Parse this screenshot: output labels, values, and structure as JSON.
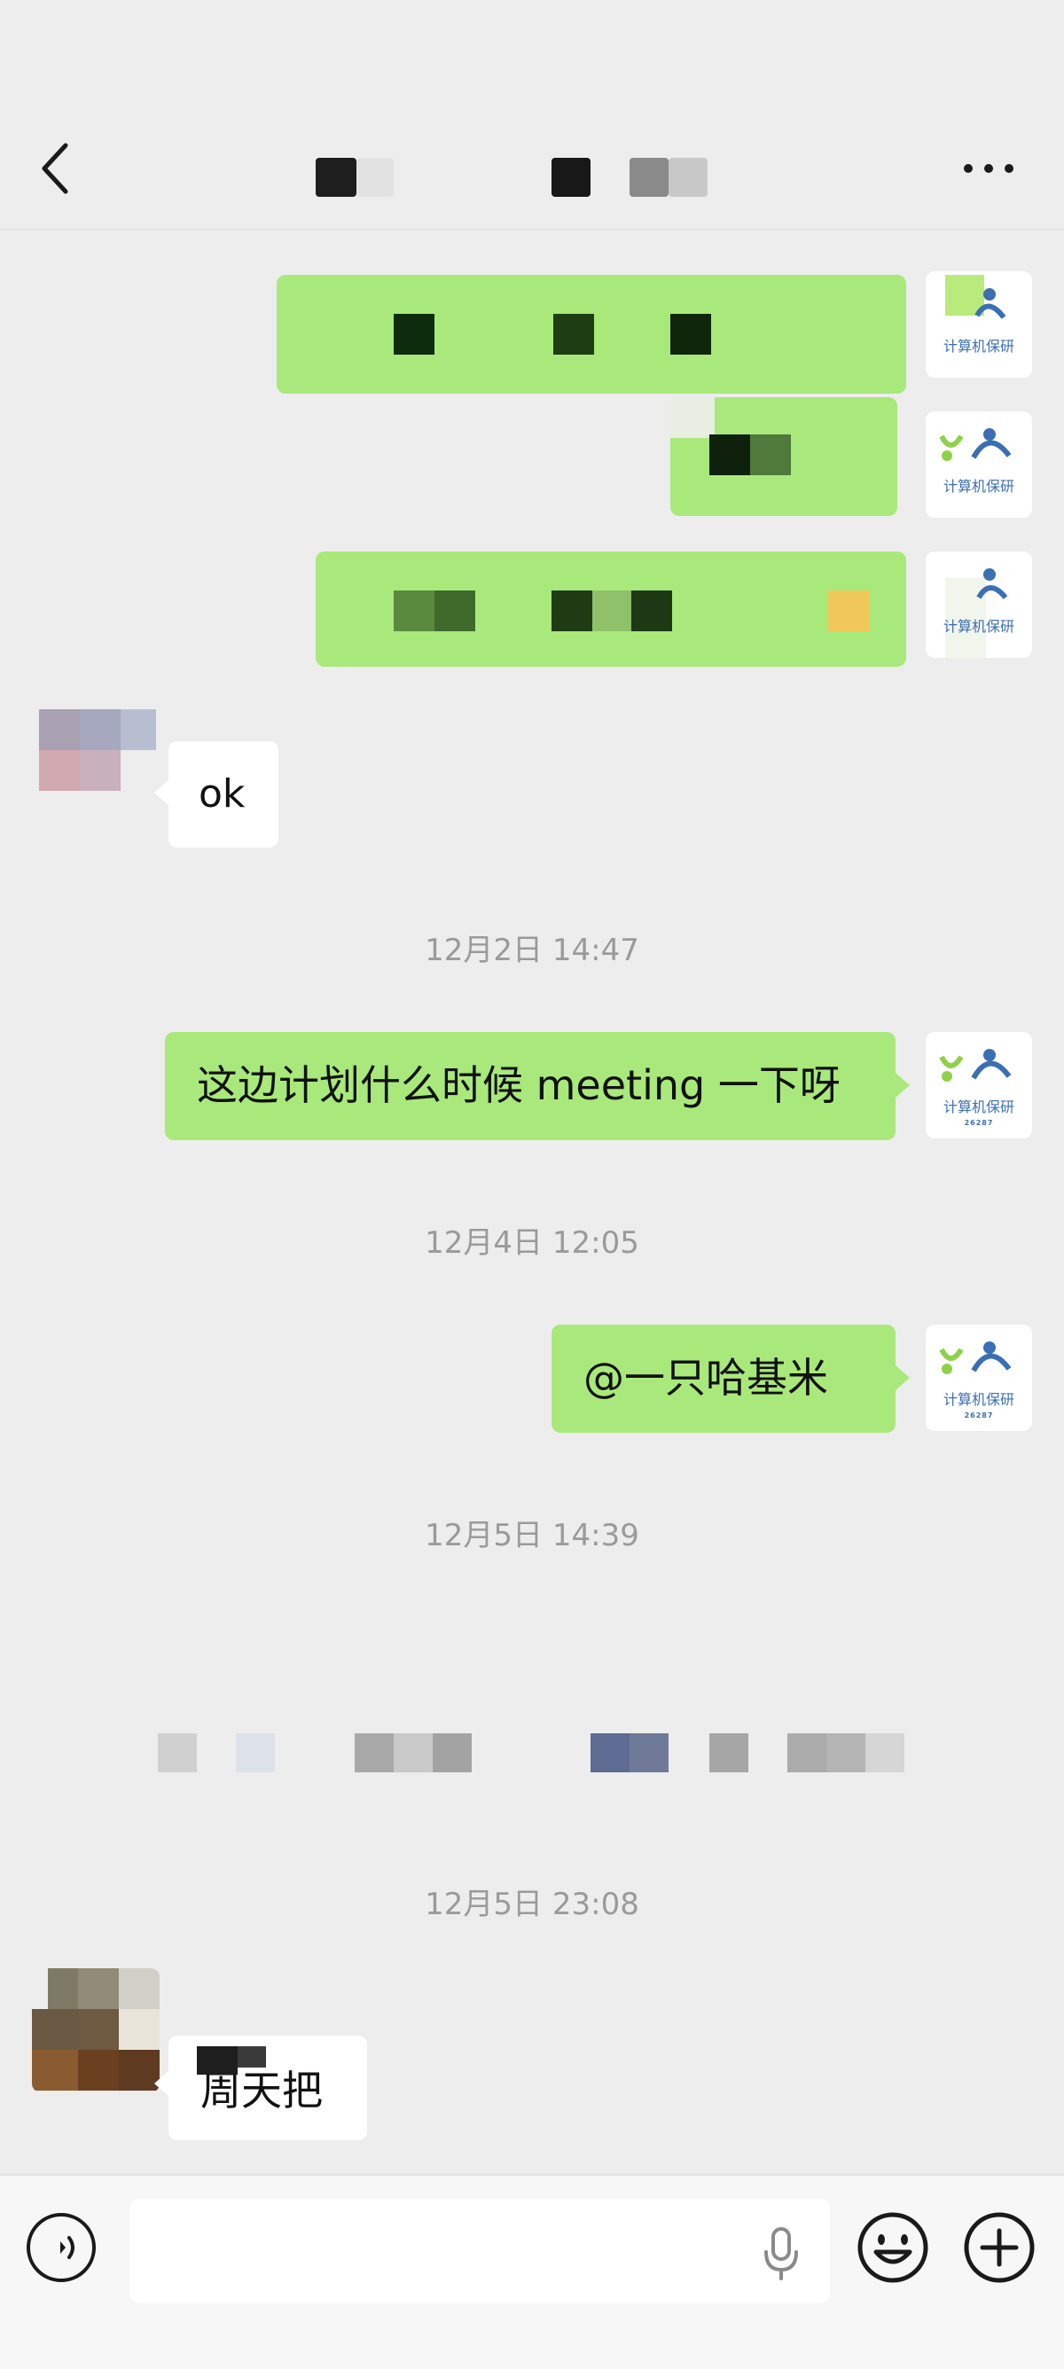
{
  "header": {
    "back_icon": "chevron-left-icon",
    "more_icon": "more-dots-icon",
    "title_redacted": true
  },
  "self_avatar": {
    "logo_text": "计算机保研",
    "logo_sub": "26287"
  },
  "messages": [
    {
      "id": "m1",
      "side": "right",
      "type": "redacted"
    },
    {
      "id": "m2",
      "side": "right",
      "type": "redacted"
    },
    {
      "id": "m3",
      "side": "right",
      "type": "redacted"
    },
    {
      "id": "m4",
      "side": "left",
      "type": "text",
      "text": "ok"
    },
    {
      "id": "ts1",
      "type": "timestamp",
      "text": "12月2日 14:47"
    },
    {
      "id": "m5",
      "side": "right",
      "type": "text",
      "text": "这边计划什么时候 meeting 一下呀"
    },
    {
      "id": "ts2",
      "type": "timestamp",
      "text": "12月4日 12:05"
    },
    {
      "id": "m6",
      "side": "right",
      "type": "text",
      "text": "@一只哈基米"
    },
    {
      "id": "ts3",
      "type": "timestamp",
      "text": "12月5日 14:39"
    },
    {
      "id": "sys1",
      "type": "redacted-system"
    },
    {
      "id": "ts4",
      "type": "timestamp",
      "text": "12月5日 23:08"
    },
    {
      "id": "m7",
      "side": "left",
      "type": "text",
      "text": "周天把"
    }
  ],
  "input": {
    "voice_icon": "voice-mode-icon",
    "mic_icon": "microphone-icon",
    "emoji_icon": "emoji-icon",
    "plus_icon": "plus-icon",
    "placeholder": ""
  },
  "colors": {
    "background": "#ededed",
    "bubble_green": "#a9e97b",
    "bubble_white": "#ffffff",
    "timestamp": "#9a9a9a"
  }
}
